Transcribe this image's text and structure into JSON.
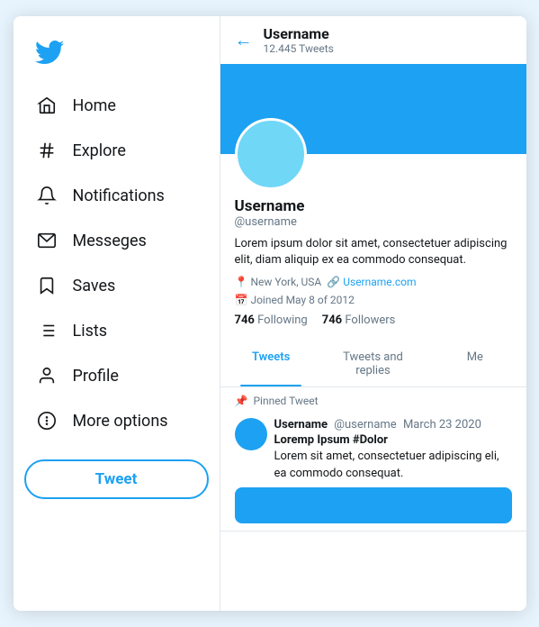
{
  "sidebar": {
    "logo_alt": "Twitter logo",
    "nav_items": [
      {
        "id": "home",
        "label": "Home",
        "icon": "home"
      },
      {
        "id": "explore",
        "label": "Explore",
        "icon": "hashtag"
      },
      {
        "id": "notifications",
        "label": "Notifications",
        "icon": "bell"
      },
      {
        "id": "messages",
        "label": "Messeges",
        "icon": "mail"
      },
      {
        "id": "saves",
        "label": "Saves",
        "icon": "bookmark"
      },
      {
        "id": "lists",
        "label": "Lists",
        "icon": "list"
      },
      {
        "id": "profile",
        "label": "Profile",
        "icon": "person"
      },
      {
        "id": "more",
        "label": "More options",
        "icon": "more"
      }
    ],
    "tweet_button_label": "Tweet"
  },
  "profile": {
    "back_label": "←",
    "header_username": "Username",
    "header_tweets": "12.445 Tweets",
    "display_name": "Username",
    "handle": "@username",
    "bio": "Lorem ipsum dolor sit amet, consectetuer adipiscing elit, diam aliquip ex ea commodo consequat.",
    "location": "New York, USA",
    "website": "Username.com",
    "joined": "Joined May 8 of 2012",
    "following_count": "746",
    "following_label": "Following",
    "followers_count": "746",
    "followers_label": "Followers",
    "tabs": [
      {
        "id": "tweets",
        "label": "Tweets",
        "active": true
      },
      {
        "id": "replies",
        "label": "Tweets and replies",
        "active": false
      },
      {
        "id": "more",
        "label": "Me",
        "active": false
      }
    ],
    "pinned_label": "Pinned Tweet",
    "tweet": {
      "author_name": "Username",
      "author_handle": "@username",
      "date": "March 23 2020",
      "title": "Loremp Ipsum #Dolor",
      "text": "Lorem sit amet, consectetuer adipiscing eli, ea commodo consequat."
    }
  }
}
